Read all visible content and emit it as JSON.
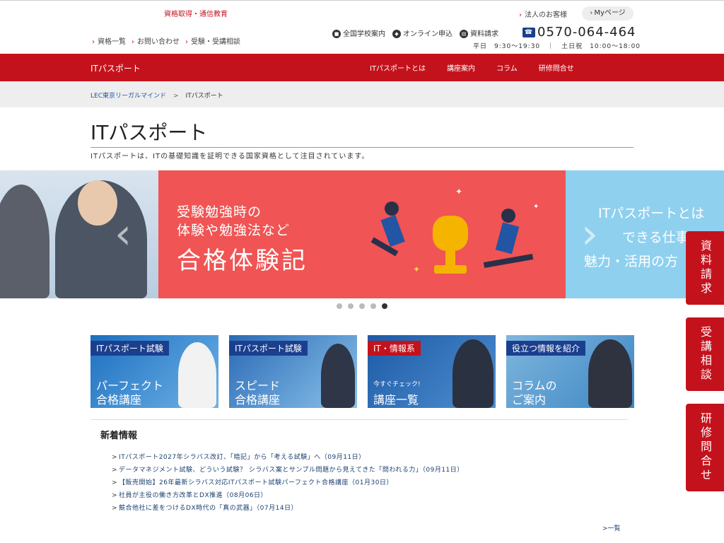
{
  "header": {
    "tagline": "資格取得・通信教育",
    "links": [
      "資格一覧",
      "お問い合わせ",
      "受験・受講相談"
    ],
    "corporate": "法人のお客様",
    "mypage": "Myページ",
    "utility": [
      {
        "icon": "school-icon",
        "label": "全国学校案内"
      },
      {
        "icon": "cart-icon",
        "label": "オンライン申込"
      },
      {
        "icon": "document-icon",
        "label": "資料請求"
      }
    ],
    "phone": "0570-064-464",
    "hours": "平日　9:30～19:30　｜　土日祝　10:00～18:00"
  },
  "nav": {
    "title": "ITパスポート",
    "items": [
      "ITパスポートとは",
      "講座案内",
      "コラム",
      "研修問合せ"
    ]
  },
  "breadcrumb": {
    "home": "LEC東京リーガルマインド",
    "sep": ">",
    "current": "ITパスポート"
  },
  "page": {
    "title": "ITパスポート",
    "lead": "ITパスポートは、ITの基礎知識を証明できる国家資格として注目されています。"
  },
  "carousel": {
    "main": {
      "line1": "受験勉強時の",
      "line2": "体験や勉強法など",
      "line3": "合格体験記"
    },
    "right": {
      "line1": "ITパスポートとは",
      "line2": "できる仕事",
      "line3": "魅力・活用の方"
    },
    "prev": "‹",
    "next": "›",
    "active_dot": 5,
    "dot_count": 5
  },
  "cards": [
    {
      "tag": "ITパスポート試験",
      "line1": "パーフェクト",
      "line2": "合格講座",
      "small": ""
    },
    {
      "tag": "ITパスポート試験",
      "line1": "スピード",
      "line2": "合格講座",
      "small": ""
    },
    {
      "tag": "IT・情報系",
      "line1": "",
      "line2": "講座一覧",
      "small": "今すぐチェック!"
    },
    {
      "tag": "役立つ情報を紹介",
      "line1": "コラムの",
      "line2": "ご案内",
      "small": ""
    }
  ],
  "news": {
    "title": "新着情報",
    "items": [
      "ITパスポート2027年シラバス改訂、「暗記」から「考える試験」へ（09月11日）",
      "データマネジメント試験、どういう試験？ シラバス案とサンプル問題から見えてきた「問われる力」（09月11日）",
      "【販売開始】26年最新シラバス対応ITパスポート試験パーフェクト合格講座（01月30日）",
      "社員が主役の働き方改革とDX推進（08月06日）",
      "競合他社に差をつけるDX時代の「真の武器」（07月14日）"
    ],
    "more": "一覧"
  },
  "side_buttons": [
    "資料請求",
    "受講相談",
    "研修問合せ"
  ],
  "colors": {
    "brand_red": "#c4121c",
    "slide_red": "#f05454",
    "slide_blue": "#8fd0ef"
  }
}
